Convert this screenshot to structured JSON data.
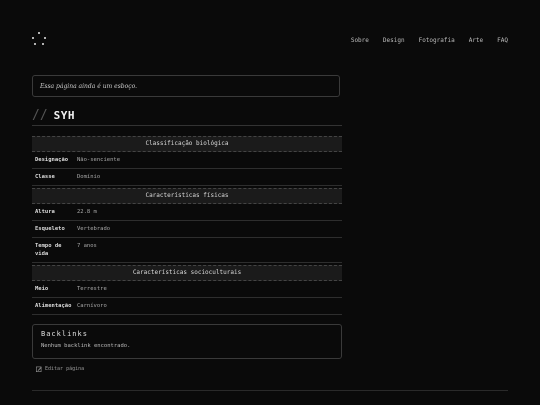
{
  "nav": [
    "Sobre",
    "Design",
    "Fotografia",
    "Arte",
    "FAQ"
  ],
  "notice": "Essa página ainda é um esboço.",
  "title_prefix": "//",
  "title": "SYH",
  "infobox": {
    "sections": [
      {
        "heading": "Classificação biológica",
        "rows": [
          {
            "key": "Designação",
            "value": "Não-senciente"
          },
          {
            "key": "Classe",
            "value": "Domínio"
          }
        ]
      },
      {
        "heading": "Características físicas",
        "rows": [
          {
            "key": "Altura",
            "value": "22.8 m"
          },
          {
            "key": "Esqueleto",
            "value": "Vertebrado"
          },
          {
            "key": "Tempo de vida",
            "value": "7 anos"
          }
        ]
      },
      {
        "heading": "Características socioculturais",
        "rows": [
          {
            "key": "Meio",
            "value": "Terrestre"
          },
          {
            "key": "Alimentação",
            "value": "Carnívoro"
          }
        ]
      }
    ]
  },
  "backlinks": {
    "title": "Backlinks",
    "text": "Nenhum backlink encontrado."
  },
  "edit_label": "Editar página",
  "icons": {
    "logo": "dots-logo-icon",
    "edit": "edit-icon"
  }
}
